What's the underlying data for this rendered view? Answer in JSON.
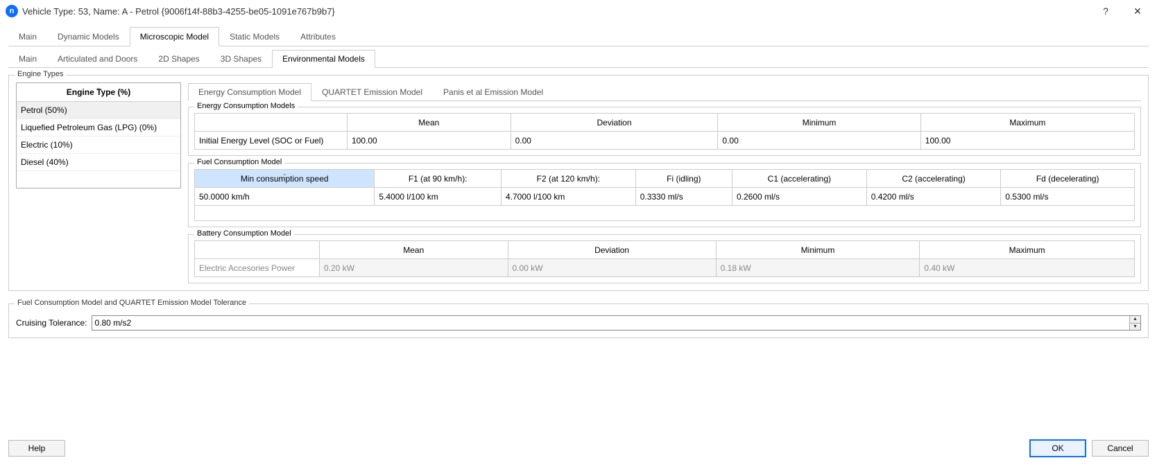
{
  "titlebar": {
    "icon_letter": "n",
    "title": "Vehicle Type: 53, Name: A - Petrol  {9006f14f-88b3-4255-be05-1091e767b9b7}",
    "help_icon": "?",
    "close_icon": "✕"
  },
  "tabs_top": {
    "main": "Main",
    "dynamic": "Dynamic Models",
    "micro": "Microscopic Model",
    "static_m": "Static Models",
    "attributes": "Attributes"
  },
  "tabs_sub": {
    "main": "Main",
    "artic": "Articulated and Doors",
    "shapes2d": "2D Shapes",
    "shapes3d": "3D Shapes",
    "env": "Environmental Models"
  },
  "engine_types_group": {
    "title": "Engine Types",
    "header": "Engine Type (%)",
    "rows": [
      "Petrol (50%)",
      "Liquefied Petroleum Gas (LPG) (0%)",
      "Electric (10%)",
      "Diesel (40%)"
    ]
  },
  "inner_tabs": {
    "energy": "Energy Consumption Model",
    "quartet": "QUARTET Emission Model",
    "panis": "Panis et al Emission Model"
  },
  "energy_models_group": {
    "title": "Energy Consumption Models",
    "headers": {
      "mean": "Mean",
      "dev": "Deviation",
      "min": "Minimum",
      "max": "Maximum"
    },
    "rowlabel": "Initial Energy Level (SOC or Fuel)",
    "values": {
      "mean": "100.00",
      "dev": "0.00",
      "min": "0.00",
      "max": "100.00"
    }
  },
  "fuel_group": {
    "title": "Fuel Consumption Model",
    "headers": {
      "minspeed": "Min consumption speed",
      "f1": "F1 (at 90 km/h):",
      "f2": "F2 (at 120 km/h):",
      "fi": "Fi (idling)",
      "c1": "C1 (accelerating)",
      "c2": "C2 (accelerating)",
      "fd": "Fd (decelerating)"
    },
    "values": {
      "minspeed": "50.0000  km/h",
      "f1": "5.4000  l/100 km",
      "f2": "4.7000  l/100 km",
      "fi": "0.3330  ml/s",
      "c1": "0.2600  ml/s",
      "c2": "0.4200  ml/s",
      "fd": "0.5300  ml/s"
    }
  },
  "battery_group": {
    "title": "Battery Consumption Model",
    "headers": {
      "mean": "Mean",
      "dev": "Deviation",
      "min": "Minimum",
      "max": "Maximum"
    },
    "rowlabel": "Electric Accesories Power",
    "values": {
      "mean": "0.20 kW",
      "dev": "0.00 kW",
      "min": "0.18 kW",
      "max": "0.40 kW"
    }
  },
  "tolerance_group": {
    "title": "Fuel Consumption Model and QUARTET Emission Model Tolerance",
    "label": "Cruising Tolerance:",
    "value": "0.80 m/s2"
  },
  "footer": {
    "help": "Help",
    "ok": "OK",
    "cancel": "Cancel"
  }
}
